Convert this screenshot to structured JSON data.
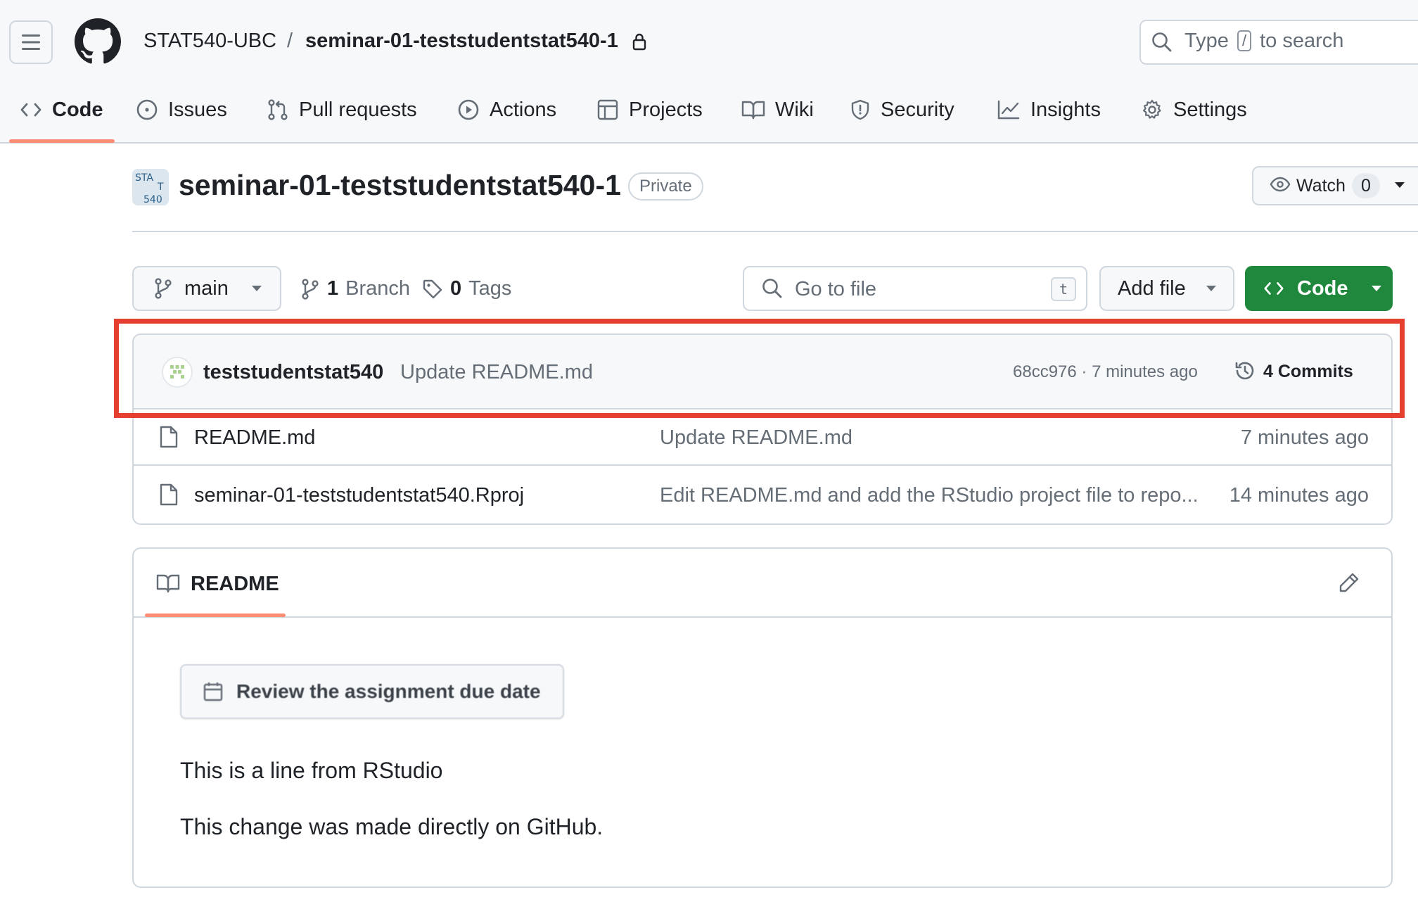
{
  "header": {
    "owner": "STAT540-UBC",
    "separator": "/",
    "repo": "seminar-01-teststudentstat540-1",
    "search": {
      "prefix": "Type",
      "key": "/",
      "suffix": "to search"
    }
  },
  "tabs": [
    {
      "label": "Code",
      "icon": "code-icon",
      "selected": true
    },
    {
      "label": "Issues",
      "icon": "issue-opened-icon"
    },
    {
      "label": "Pull requests",
      "icon": "git-pull-request-icon"
    },
    {
      "label": "Actions",
      "icon": "play-icon"
    },
    {
      "label": "Projects",
      "icon": "table-icon"
    },
    {
      "label": "Wiki",
      "icon": "book-icon"
    },
    {
      "label": "Security",
      "icon": "shield-icon"
    },
    {
      "label": "Insights",
      "icon": "graph-icon"
    },
    {
      "label": "Settings",
      "icon": "gear-icon"
    }
  ],
  "repo_header": {
    "avatar_text": [
      "STA",
      "T",
      "540"
    ],
    "title": "seminar-01-teststudentstat540-1",
    "visibility": "Private",
    "watch_label": "Watch",
    "watch_count": "0"
  },
  "branch_bar": {
    "branch": "main",
    "branch_count": "1",
    "branch_word": "Branch",
    "tag_count": "0",
    "tag_word": "Tags",
    "goto_placeholder": "Go to file",
    "goto_key": "t",
    "add_file": "Add file",
    "code": "Code"
  },
  "latest_commit": {
    "author": "teststudentstat540",
    "message": "Update README.md",
    "meta": "68cc976 · 7 minutes ago",
    "commits_label": "4 Commits"
  },
  "files": [
    {
      "name": "README.md",
      "message": "Update README.md",
      "time": "7 minutes ago"
    },
    {
      "name": "seminar-01-teststudentstat540.Rproj",
      "message": "Edit README.md and add the RStudio project file to repo...",
      "time": "14 minutes ago"
    }
  ],
  "readme": {
    "title": "README",
    "due_button": "Review the assignment due date",
    "line1": "This is a line from RStudio",
    "line2": "This change was made directly on GitHub."
  },
  "colors": {
    "accent_underline": "#fd8c73",
    "code_button": "#1f883d",
    "highlight": "#e5402f"
  }
}
